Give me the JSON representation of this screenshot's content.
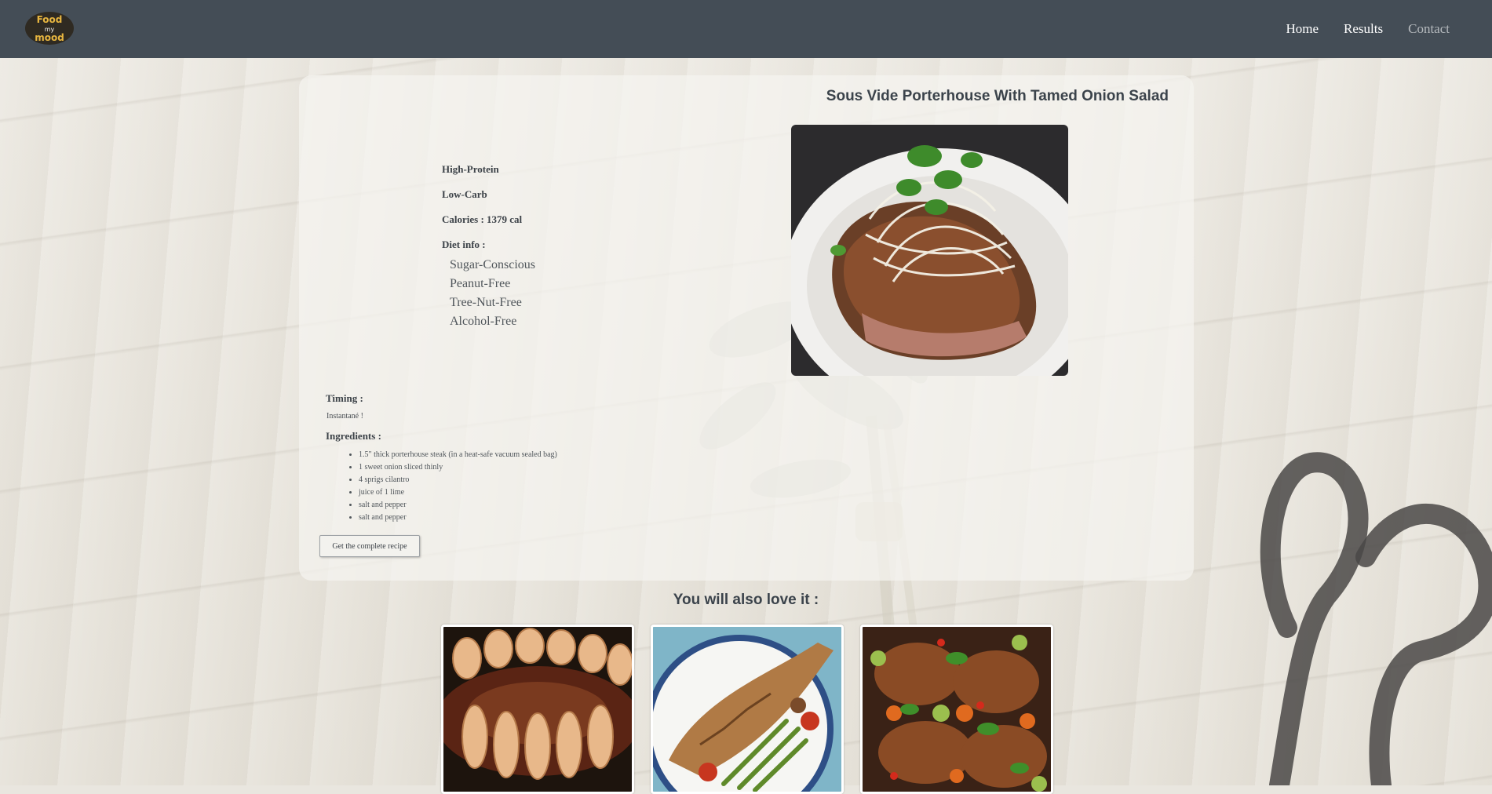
{
  "nav": {
    "logo_text": [
      "Food",
      "my",
      "mood"
    ],
    "links": [
      {
        "label": "Home"
      },
      {
        "label": "Results"
      },
      {
        "label": "Contact"
      }
    ]
  },
  "recipe": {
    "title": "Sous Vide Porterhouse With Tamed Onion Salad",
    "tags": [
      "High-Protein",
      "Low-Carb",
      "Calories : 1379 cal",
      "Diet info :"
    ],
    "diet_info": [
      "Sugar-Conscious",
      "Peanut-Free",
      "Tree-Nut-Free",
      "Alcohol-Free"
    ],
    "timing_label": "Timing :",
    "timing_value": "Instantané !",
    "ingredients_label": "Ingredients :",
    "ingredients": [
      "1.5\" thick porterhouse steak (in a heat-safe vacuum sealed bag)",
      "1 sweet onion sliced thinly",
      "4 sprigs cilantro",
      "juice of 1 lime",
      "salt and pepper",
      "salt and pepper"
    ],
    "button_label": "Get the complete recipe"
  },
  "suggestions": {
    "title": "You will also love it :"
  },
  "colors": {
    "nav_bg": "#444d56",
    "title_text": "#3b434b"
  }
}
